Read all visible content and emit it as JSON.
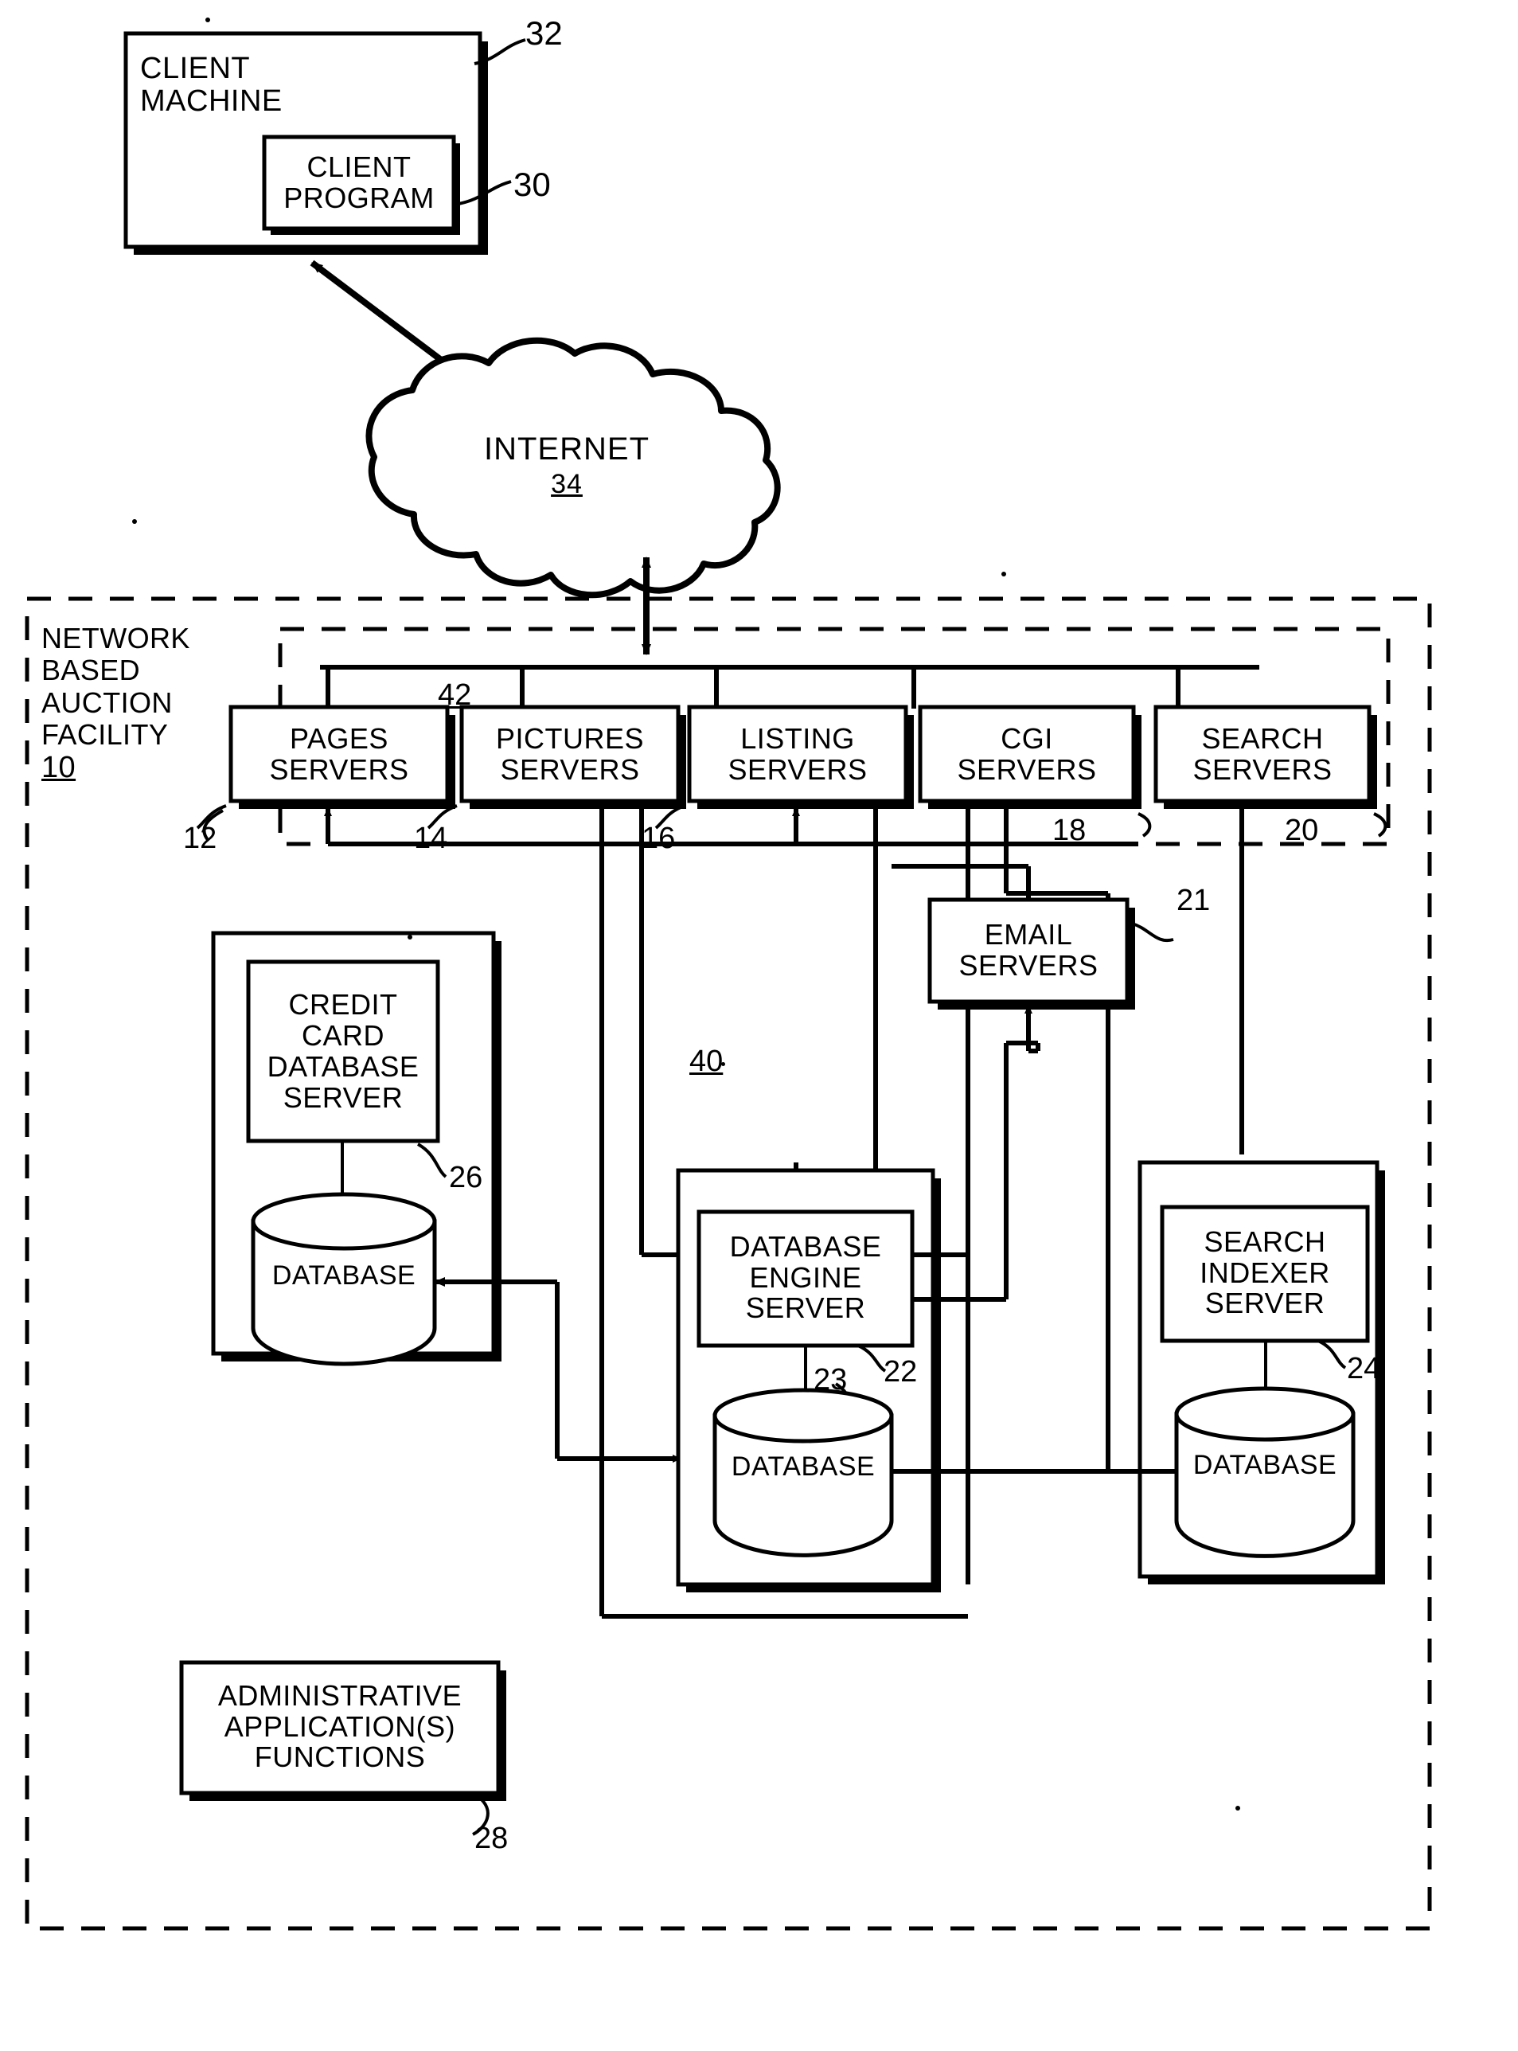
{
  "figure": {
    "title": "Network based auction facility block diagram",
    "stroke_color": "#000000",
    "background_color": "#ffffff"
  },
  "client_machine": {
    "label_lines": [
      "CLIENT",
      "MACHINE"
    ],
    "ref": "32",
    "client_program": {
      "label_lines": [
        "CLIENT",
        "PROGRAM"
      ],
      "ref": "30"
    }
  },
  "internet": {
    "label": "INTERNET",
    "ref": "34"
  },
  "facility": {
    "label_lines": [
      "NETWORK",
      "BASED",
      "AUCTION",
      "FACILITY"
    ],
    "ref": "10"
  },
  "bus": {
    "top_bus_ref": "42",
    "lower_bus_ref": "40"
  },
  "servers": [
    {
      "label_lines": [
        "PAGES",
        "SERVERS"
      ],
      "ref": "12"
    },
    {
      "label_lines": [
        "PICTURES",
        "SERVERS"
      ],
      "ref": "14"
    },
    {
      "label_lines": [
        "LISTING",
        "SERVERS"
      ],
      "ref": "16"
    },
    {
      "label_lines": [
        "CGI",
        "SERVERS"
      ],
      "ref": "18"
    },
    {
      "label_lines": [
        "SEARCH",
        "SERVERS"
      ],
      "ref": "20"
    }
  ],
  "email_servers": {
    "label_lines": [
      "EMAIL",
      "SERVERS"
    ],
    "ref": "21"
  },
  "credit_card": {
    "label_lines": [
      "CREDIT",
      "CARD",
      "DATABASE",
      "SERVER"
    ],
    "ref": "26",
    "database_label": "DATABASE"
  },
  "database_engine": {
    "label_lines": [
      "DATABASE",
      "ENGINE",
      "SERVER"
    ],
    "ref": "22",
    "database_label": "DATABASE",
    "database_ref": "23"
  },
  "search_indexer": {
    "label_lines": [
      "SEARCH",
      "INDEXER",
      "SERVER"
    ],
    "ref": "24",
    "database_label": "DATABASE"
  },
  "admin_apps": {
    "label_lines": [
      "ADMINISTRATIVE",
      "APPLICATION(S)",
      "FUNCTIONS"
    ],
    "ref": "28"
  }
}
